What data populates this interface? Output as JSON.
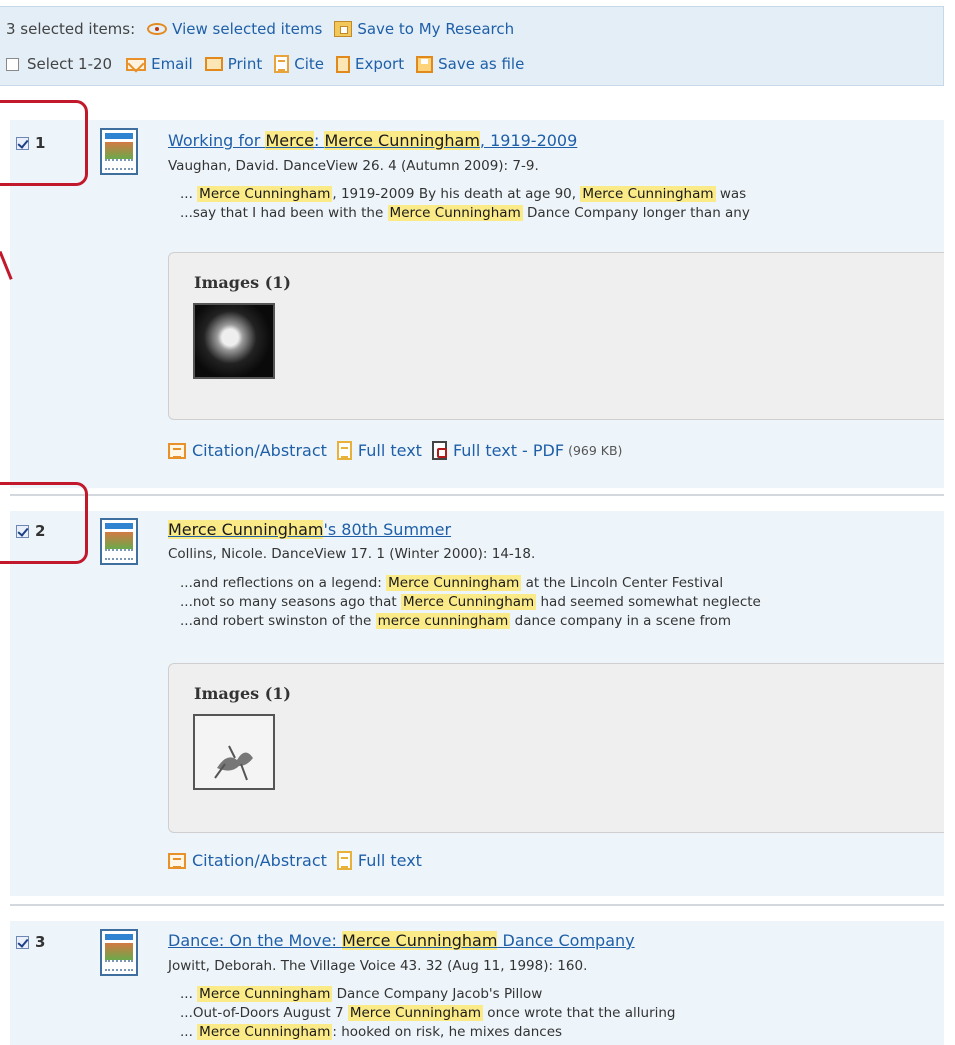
{
  "toolbar": {
    "selected_count": "3 selected items:",
    "view_selected": "View selected items",
    "save_research": "Save to My Research",
    "select_range": "Select 1-20",
    "email": "Email",
    "print": "Print",
    "cite": "Cite",
    "export": "Export",
    "save_file": "Save as file"
  },
  "results": [
    {
      "number": "1",
      "checked": true,
      "title_parts": [
        "Working for ",
        "Merce",
        ": ",
        "Merce Cunningham",
        ", 1919-2009"
      ],
      "citation": "Vaughan, David. DanceView 26. 4  (Autumn 2009): 7-9.",
      "snippets": [
        [
          "... ",
          "Merce Cunningham",
          ", 1919-2009 By his death at age 90, ",
          "Merce Cunningham",
          " was"
        ],
        [
          "...say that I had been with the ",
          "Merce Cunningham",
          " Dance Company longer than any"
        ]
      ],
      "images_label": "Images (1)",
      "links": {
        "citation": "Citation/Abstract",
        "full_text": "Full text",
        "pdf": "Full text - PDF",
        "pdf_size": "(969 KB)"
      }
    },
    {
      "number": "2",
      "checked": true,
      "title_parts": [
        "Merce Cunningham",
        "'s 80th Summer"
      ],
      "citation": "Collins, Nicole. DanceView 17. 1  (Winter 2000): 14-18.",
      "snippets": [
        [
          "...and reflections on a legend: ",
          "Merce Cunningham",
          " at the Lincoln Center Festival"
        ],
        [
          "...not so many seasons ago that ",
          "Merce Cunningham",
          " had seemed somewhat neglecte"
        ],
        [
          "...and robert swinston of the ",
          "merce cunningham",
          " dance company in a scene from"
        ]
      ],
      "images_label": "Images (1)",
      "links": {
        "citation": "Citation/Abstract",
        "full_text": "Full text"
      }
    },
    {
      "number": "3",
      "checked": true,
      "title_parts": [
        "Dance: On the Move: ",
        "Merce Cunningham",
        " Dance Company"
      ],
      "citation": "Jowitt, Deborah. The Village Voice 43. 32  (Aug 11, 1998): 160.",
      "snippets": [
        [
          "... ",
          "Merce Cunningham",
          " Dance Company Jacob's Pillow"
        ],
        [
          "...Out-of-Doors August 7 ",
          "Merce Cunningham",
          " once wrote that the alluring"
        ],
        [
          "... ",
          "Merce Cunningham",
          ": hooked on risk, he mixes dances"
        ]
      ]
    }
  ]
}
